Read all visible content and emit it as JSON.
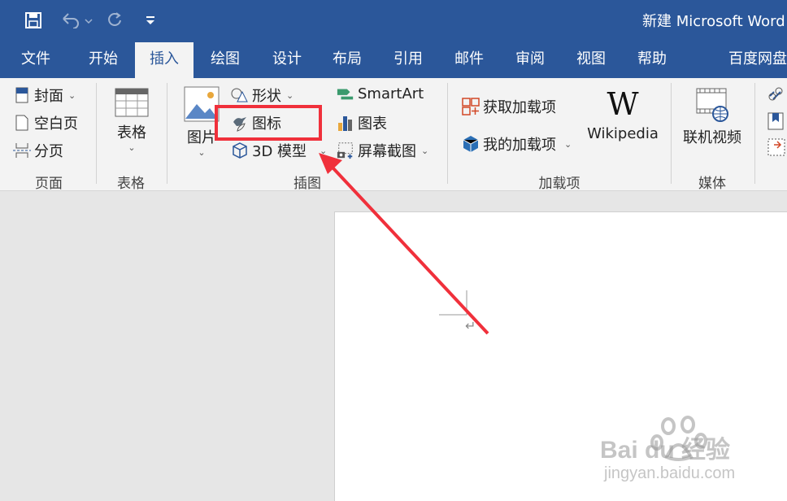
{
  "window": {
    "title": "新建 Microsoft Word"
  },
  "tabs": [
    {
      "label": "文件"
    },
    {
      "label": "开始"
    },
    {
      "label": "插入"
    },
    {
      "label": "绘图"
    },
    {
      "label": "设计"
    },
    {
      "label": "布局"
    },
    {
      "label": "引用"
    },
    {
      "label": "邮件"
    },
    {
      "label": "审阅"
    },
    {
      "label": "视图"
    },
    {
      "label": "帮助"
    },
    {
      "label": "百度网盘"
    }
  ],
  "active_tab": "插入",
  "ribbon": {
    "pages": {
      "cover": "封面",
      "blank": "空白页",
      "break": "分页",
      "group": "页面"
    },
    "tables": {
      "table": "表格",
      "group": "表格"
    },
    "illustrations": {
      "pictures": "图片",
      "shapes": "形状",
      "icons": "图标",
      "model3d": "3D 模型",
      "smartart": "SmartArt",
      "chart": "图表",
      "screenshot": "屏幕截图",
      "group": "插图"
    },
    "addins": {
      "get": "获取加载项",
      "mine": "我的加载项",
      "wikipedia": "Wikipedia",
      "group": "加载项"
    },
    "media": {
      "video": "联机视频",
      "group": "媒体"
    }
  },
  "watermark": {
    "logo": "Bai du 经验",
    "url": "jingyan.baidu.com"
  },
  "colors": {
    "accent": "#2b579a",
    "highlight": "#f0303b",
    "ribbon_bg": "#f3f3f3"
  }
}
